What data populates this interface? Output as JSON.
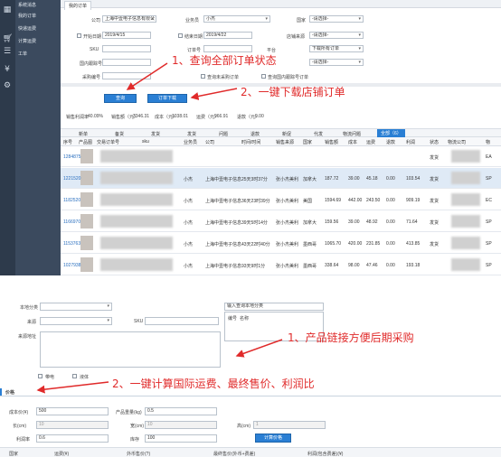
{
  "top": {
    "sidebar_icons": [
      "grid-icon",
      "cart-icon",
      "list-icon",
      "yen-icon",
      "gears-icon"
    ],
    "menu": [
      "系统消息",
      "我的订单",
      "快递运费",
      "计算运费",
      "工单"
    ],
    "menu_active": "我的订单",
    "tab": "我的订单",
    "filters": {
      "company_label": "公司",
      "company_value": "上海中壹电子信息有限公",
      "salesman_label": "业务员",
      "salesman_value": "小杰",
      "country_label": "国家",
      "country_value": "-请选择-",
      "start_label": "开始日期",
      "start_value": "2019/4/15",
      "end_label": "结束日期",
      "end_value": "2019/4/22",
      "store_label": "店铺来源",
      "store_value": "-请选择-",
      "sku_label": "SKU",
      "order_label": "订单号",
      "platform_label": "平台",
      "platform_value": "下载所有订单",
      "intl_label": "国内跟踪号",
      "intl_select_value": "-请选择-",
      "purchase_label": "采购编号",
      "checkbox_a": "查询未采购订单",
      "checkbox_b": "查询国内跟踪号订单"
    },
    "buttons": {
      "query": "查询",
      "download": "订单下载"
    },
    "annotations": [
      "1、查询全部订单状态",
      "2、一键下载店铺订单"
    ],
    "summary": {
      "profit_rate_label": "销售利润率",
      "profit_rate": "40.09%",
      "sales_label": "销售额（元）",
      "sales": "3346.31",
      "cost_label": "成本（元）",
      "cost": "1038.01",
      "freight_label": "运费（元）",
      "freight": "966.91",
      "refund_label": "退款（元）",
      "refund": "0.00"
    },
    "grid_tabs": [
      "新单",
      "备货",
      "发货",
      "发货",
      "问题",
      "退款",
      "新促",
      "代发",
      "物流问题",
      "全部（6）"
    ],
    "grid_headers": [
      "序号",
      "产品图",
      "交易订单号",
      "sku",
      "业务员",
      "公司",
      "时间/时间",
      "销售来源",
      "国家",
      "销售额",
      "成本",
      "运费",
      "退款",
      "利润",
      "状态",
      "物流公司",
      "物"
    ],
    "rows": [
      {
        "id": "1284875",
        "salesman": "",
        "company": "",
        "time": "",
        "store": "",
        "country": "",
        "sales": "",
        "cost": "",
        "freight": "",
        "refund": "",
        "profit": "",
        "status": "发货",
        "carrier": "EA"
      },
      {
        "id": "1221520",
        "salesman": "小杰",
        "company": "上海中壹电子信息",
        "time": "25天3时37分",
        "store": "张小杰美利",
        "country": "加拿大",
        "sales": "187.72",
        "cost": "39.00",
        "freight": "45.18",
        "refund": "0.00",
        "profit": "103.54",
        "status": "发货",
        "carrier": "SP"
      },
      {
        "id": "1182520",
        "salesman": "小杰",
        "company": "上海中壹电子信息",
        "time": "36天23时39分",
        "store": "张小杰美利",
        "country": "美国",
        "sales": "1594.69",
        "cost": "442.00",
        "freight": "243.50",
        "refund": "0.00",
        "profit": "909.19",
        "status": "发货",
        "carrier": "EC"
      },
      {
        "id": "1166970",
        "salesman": "小杰",
        "company": "上海中壹电子信息",
        "time": "39天5时14分",
        "store": "张小杰美利",
        "country": "加拿大",
        "sales": "159.56",
        "cost": "39.00",
        "freight": "48.92",
        "refund": "0.00",
        "profit": "71.64",
        "status": "发货",
        "carrier": "SP"
      },
      {
        "id": "1153763",
        "salesman": "小杰",
        "company": "上海中壹电子信息",
        "time": "43天22时40分",
        "store": "张小杰美利",
        "country": "墨西哥",
        "sales": "1065.70",
        "cost": "420.00",
        "freight": "231.85",
        "refund": "0.00",
        "profit": "413.85",
        "status": "发货",
        "carrier": "SP"
      },
      {
        "id": "1027938",
        "salesman": "小杰",
        "company": "上海中壹电子信息",
        "time": "93天9时1分",
        "store": "张小杰美利",
        "country": "墨西哥",
        "sales": "338.64",
        "cost": "98.00",
        "freight": "47.46",
        "refund": "0.00",
        "profit": "193.18",
        "status": "",
        "carrier": "SP"
      }
    ]
  },
  "bottom": {
    "category_label": "本地分类",
    "source_label": "来源",
    "sku_label": "SKU",
    "source_url_label": "来源地址",
    "local_cat_placeholder": "输入查询本地分类",
    "tree_col1": "编号",
    "tree_col2": "名称",
    "checkbox_elec": "带电",
    "checkbox_liquid": "液体",
    "annotation1": "1、产品链接方便后期采购",
    "annotation2": "2、一键计算国际运费、最终售价、利润比",
    "price_section": "价格",
    "cost_label": "成本价(¥)",
    "cost_value": "500",
    "weight_label": "产品重量(kg)",
    "weight_value": "0.5",
    "length_label": "长(cm)",
    "length_value": "10",
    "width_label": "宽(cm)",
    "width_value": "10",
    "height_label": "高(cm)",
    "height_value": "1",
    "profit_label": "利润率",
    "profit_value": "0.6",
    "stock_label": "库存",
    "stock_value": "100",
    "calc_button": "计算价格",
    "footer_headers": [
      "国家",
      "运费(¥)",
      "外币售价(?)",
      "最终售价(外币+费差)",
      "利润(包含费差)(¥)"
    ]
  }
}
